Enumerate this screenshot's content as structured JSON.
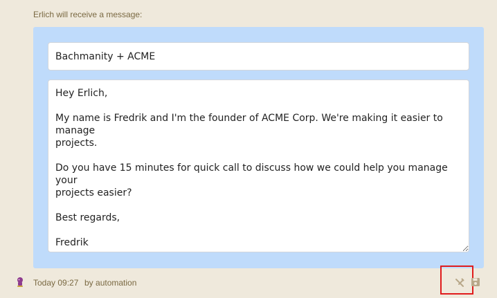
{
  "header": {
    "recipient_label": "Erlich will receive a message:"
  },
  "compose": {
    "subject_value": "Bachmanity + ACME",
    "body_value": "Hey Erlich,\n\nMy name is Fredrik and I'm the founder of ACME Corp. We're making it easier to manage\nprojects.\n\nDo you have 15 minutes for quick call to discuss how we could help you manage your\nprojects easier?\n\nBest regards,\n\nFredrik"
  },
  "footer": {
    "timestamp": "Today 09:27",
    "by_prefix": "by",
    "author": "automation",
    "avatar_icon": "robot-avatar-icon",
    "cancel_icon": "tools-icon",
    "save_icon": "floppy-disk-icon"
  },
  "colors": {
    "background": "#efe9dc",
    "card": "#bfdbfb",
    "muted_text": "#7a6942",
    "highlight_box": "#e01b1b",
    "icon": "#b8a88a"
  }
}
